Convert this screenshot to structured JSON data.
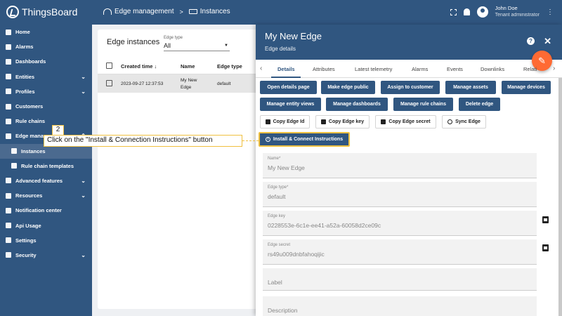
{
  "app": {
    "name": "ThingsBoard"
  },
  "breadcrumb": {
    "parent": "Edge management",
    "separator": ">",
    "current": "Instances"
  },
  "user": {
    "name": "John Doe",
    "role": "Tenant administrator"
  },
  "sidebar": {
    "items": [
      {
        "label": "Home"
      },
      {
        "label": "Alarms"
      },
      {
        "label": "Dashboards"
      },
      {
        "label": "Entities",
        "chevron": "⌄"
      },
      {
        "label": "Profiles",
        "chevron": "⌄"
      },
      {
        "label": "Customers"
      },
      {
        "label": "Rule chains"
      },
      {
        "label": "Edge manage",
        "chevron": "⌃"
      },
      {
        "label": "Instances"
      },
      {
        "label": "Rule chain templates"
      },
      {
        "label": "Advanced features",
        "chevron": "⌄"
      },
      {
        "label": "Resources",
        "chevron": "⌄"
      },
      {
        "label": "Notification center"
      },
      {
        "label": "Api Usage"
      },
      {
        "label": "Settings"
      },
      {
        "label": "Security",
        "chevron": "⌄"
      }
    ]
  },
  "list": {
    "title": "Edge instances",
    "filter_label": "Edge type",
    "filter_value": "All",
    "columns": {
      "created": "Created time ↓",
      "name": "Name",
      "type": "Edge type"
    },
    "rows": [
      {
        "created": "2023-09-27 12:37:53",
        "name_line1": "My New",
        "name_line2": "Edge",
        "type": "default"
      }
    ]
  },
  "detail": {
    "title": "My New Edge",
    "subtitle": "Edge details",
    "tabs": [
      "Details",
      "Attributes",
      "Latest telemetry",
      "Alarms",
      "Events",
      "Downlinks",
      "Relati"
    ],
    "buttons": {
      "open_details": "Open details page",
      "make_public": "Make edge public",
      "assign_customer": "Assign to customer",
      "manage_assets": "Manage assets",
      "manage_devices": "Manage devices",
      "manage_entity_views": "Manage entity views",
      "manage_dashboards": "Manage dashboards",
      "manage_rule_chains": "Manage rule chains",
      "delete_edge": "Delete edge",
      "copy_edge_id": "Copy Edge Id",
      "copy_edge_key": "Copy Edge key",
      "copy_edge_secret": "Copy Edge secret",
      "sync_edge": "Sync Edge",
      "install_instructions": "Install & Connect Instructions"
    },
    "fields": {
      "name_label": "Name*",
      "name_value": "My New Edge",
      "type_label": "Edge type*",
      "type_value": "default",
      "key_label": "Edge key",
      "key_value": "0228553e-6c1e-ee41-a52a-60058d2ce09c",
      "secret_label": "Edge secret",
      "secret_value": "rs49u009dnbfahoqijic",
      "label_placeholder": "Label",
      "description_placeholder": "Description"
    }
  },
  "annotation": {
    "step": "2",
    "text": "Click on the \"Install & Connection Instructions\" button"
  },
  "colors": {
    "primary": "#305680",
    "accent": "#ff6a33",
    "highlight": "#f0c040"
  }
}
